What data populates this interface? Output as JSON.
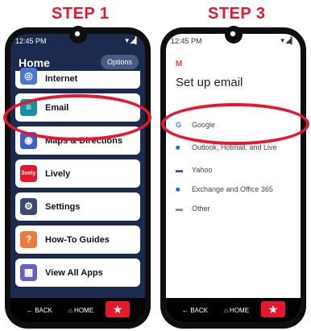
{
  "labels": {
    "step1": "STEP 1",
    "step3": "STEP 3"
  },
  "phone1": {
    "time": "12:45 PM",
    "signal": "▼◢▎",
    "title": "Home",
    "options": "Options",
    "items": [
      {
        "label": "Internet",
        "icon": "globe-icon",
        "color": "#4a77d4",
        "glyph": "◎"
      },
      {
        "label": "Email",
        "icon": "email-icon",
        "color": "#1a8fa0",
        "glyph": "≡"
      },
      {
        "label": "Maps & Directions",
        "icon": "map-pin-icon",
        "color": "#3a5fc8",
        "glyph": "◉"
      },
      {
        "label": "Lively",
        "icon": "lively-logo-icon",
        "color": "#e5182e",
        "glyph": "lively"
      },
      {
        "label": "Settings",
        "icon": "gear-icon",
        "color": "#3b4a6e",
        "glyph": "⚙"
      },
      {
        "label": "How-To Guides",
        "icon": "question-icon",
        "color": "#ef7a3c",
        "glyph": "?"
      },
      {
        "label": "View All Apps",
        "icon": "grid-icon",
        "color": "#6a5fc8",
        "glyph": "▦"
      }
    ],
    "nav": {
      "back": "← BACK",
      "home": "⌂ HOME",
      "star": "★"
    }
  },
  "phone3": {
    "time": "12:45 PM",
    "signal": "▼◢▎",
    "gmail": "M",
    "title": "Set up email",
    "providers": [
      {
        "label": "Google",
        "icon": "google-icon",
        "glyph": "G",
        "color": "#4285f4"
      },
      {
        "label": "Outlook, Hotmail, and Live",
        "icon": "outlook-icon",
        "glyph": "■",
        "color": "#0072c6"
      },
      {
        "label": "Yahoo",
        "icon": "yahoo-icon",
        "glyph": "▬",
        "color": "#5f2eb3"
      },
      {
        "label": "Exchange and Office 365",
        "icon": "exchange-icon",
        "glyph": "■",
        "color": "#0072c6"
      },
      {
        "label": "Other",
        "icon": "other-mail-icon",
        "glyph": "▬",
        "color": "#888888"
      }
    ],
    "nav": {
      "back": "← BACK",
      "home": "⌂ HOME",
      "star": "★"
    }
  }
}
